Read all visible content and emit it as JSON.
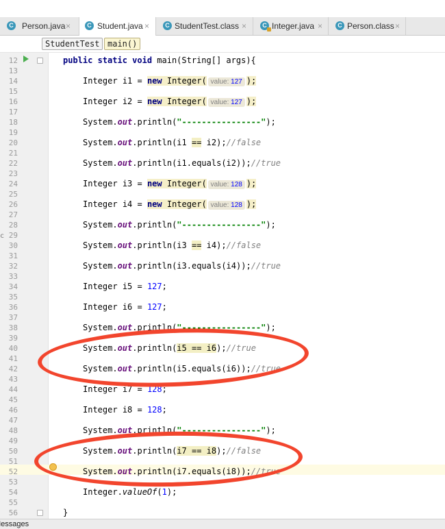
{
  "tabs": [
    {
      "label": "Person.java",
      "icon": "C"
    },
    {
      "label": "Student.java",
      "icon": "C",
      "active": true
    },
    {
      "label": "StudentTest.class",
      "icon": "C"
    },
    {
      "label": "Integer.java",
      "icon": "C"
    },
    {
      "label": "Person.class",
      "icon": "C"
    }
  ],
  "close_glyph": "×",
  "breadcrumb": [
    "StudentTest",
    "main()"
  ],
  "line_numbers": [
    "12",
    "13",
    "14",
    "15",
    "16",
    "17",
    "18",
    "19",
    "20",
    "21",
    "22",
    "23",
    "24",
    "25",
    "26",
    "27",
    "28",
    "29",
    "30",
    "31",
    "32",
    "33",
    "34",
    "35",
    "36",
    "37",
    "38",
    "39",
    "40",
    "41",
    "42",
    "43",
    "44",
    "45",
    "46",
    "47",
    "48",
    "49",
    "50",
    "51",
    "52",
    "53",
    "54",
    "55",
    "56"
  ],
  "code": {
    "l12": {
      "kw": "public static void",
      "rest": " main(String[] args){"
    },
    "integer": "Integer",
    "new_kw": "new",
    "ctor": "Integer(",
    "hint_label": "value:",
    "system": "System.",
    "out": "out",
    "println": ".println(",
    "v127": "127",
    "v128": "128",
    "v1": "1",
    "close_stmt": ");",
    "dashes": "\"----------------\"",
    "i1": "i1",
    "i2": "i2",
    "i3": "i3",
    "i4": "i4",
    "i5": "i5",
    "i6": "i6",
    "i7": "i7",
    "i8": "i8",
    "eq_op": "==",
    "assign": " = ",
    "semicolon": ";",
    "equals": ".equals(",
    "close_paren": "));",
    "close_one": ");",
    "c_false": "//false",
    "c_true": "//true",
    "valueof_prefix": "Integer.",
    "valueof": "valueOf",
    "valueof_open": "(",
    "closing_brace": "}"
  },
  "bottom_label": "Messages",
  "left_glyph": "c",
  "colors": {
    "annotation_circle": "#f2452d",
    "keyword": "#000080",
    "number": "#0000ff",
    "string": "#008000",
    "comment": "#808080"
  }
}
